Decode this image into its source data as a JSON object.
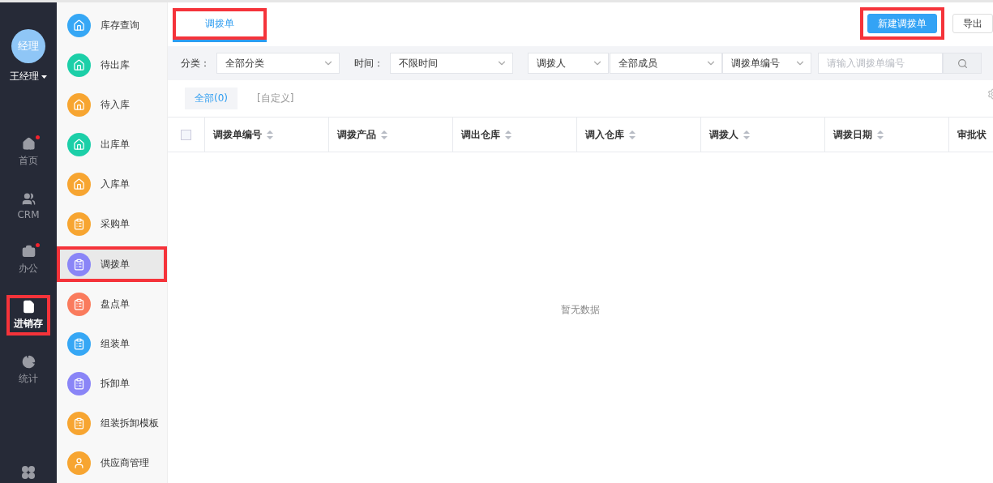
{
  "user": {
    "avatar_text": "经理",
    "name": "王经理"
  },
  "nav": [
    {
      "label": "首页",
      "badge": true,
      "selected": false,
      "highlighted": false
    },
    {
      "label": "CRM",
      "badge": false,
      "selected": false,
      "highlighted": false
    },
    {
      "label": "办公",
      "badge": true,
      "selected": false,
      "highlighted": false
    },
    {
      "label": "进销存",
      "badge": false,
      "selected": true,
      "highlighted": true
    },
    {
      "label": "统计",
      "badge": false,
      "selected": false,
      "highlighted": false
    }
  ],
  "subnav": [
    {
      "label": "库存查询",
      "color": "#36a7f5",
      "selected": false,
      "highlighted": false
    },
    {
      "label": "待出库",
      "color": "#1ccfa8",
      "selected": false,
      "highlighted": false
    },
    {
      "label": "待入库",
      "color": "#f7a531",
      "selected": false,
      "highlighted": false
    },
    {
      "label": "出库单",
      "color": "#1ccfa8",
      "selected": false,
      "highlighted": false
    },
    {
      "label": "入库单",
      "color": "#f7a531",
      "selected": false,
      "highlighted": false
    },
    {
      "label": "采购单",
      "color": "#f7a531",
      "selected": false,
      "highlighted": false
    },
    {
      "label": "调拨单",
      "color": "#8a85f7",
      "selected": true,
      "highlighted": true
    },
    {
      "label": "盘点单",
      "color": "#fa7b5d",
      "selected": false,
      "highlighted": false
    },
    {
      "label": "组装单",
      "color": "#36a7f5",
      "selected": false,
      "highlighted": false
    },
    {
      "label": "拆卸单",
      "color": "#8a85f7",
      "selected": false,
      "highlighted": false
    },
    {
      "label": "组装拆卸模板",
      "color": "#f7a531",
      "selected": false,
      "highlighted": false
    },
    {
      "label": "供应商管理",
      "color": "#f7a531",
      "selected": false,
      "highlighted": false
    }
  ],
  "page_tabs": [
    {
      "label": "调拨单",
      "selected": true,
      "highlighted": true
    }
  ],
  "actions": [
    {
      "label": "新建调拨单",
      "kind": "primary",
      "highlighted": true
    },
    {
      "label": "导出",
      "kind": "default",
      "highlighted": false
    }
  ],
  "filters": [
    {
      "kind": "label",
      "text": "分类："
    },
    {
      "kind": "select",
      "value": "全部分类"
    },
    {
      "kind": "label",
      "text": "时间："
    },
    {
      "kind": "select",
      "value": "不限时间"
    },
    {
      "kind": "select",
      "value": "调拨人"
    },
    {
      "kind": "select",
      "value": "全部成员"
    },
    {
      "kind": "select",
      "value": "调拨单编号"
    },
    {
      "kind": "search",
      "placeholder": "请输入调拨单编号"
    }
  ],
  "view_tabs": [
    {
      "label": "全部(0)",
      "selected": true
    },
    {
      "label": "[自定义]",
      "selected": false
    }
  ],
  "table": {
    "all_checked": false,
    "columns": [
      "调拨单编号",
      "调拨产品",
      "调出仓库",
      "调入仓库",
      "调拨人",
      "调拨日期",
      "审批状"
    ],
    "empty_text": "暂无数据"
  }
}
